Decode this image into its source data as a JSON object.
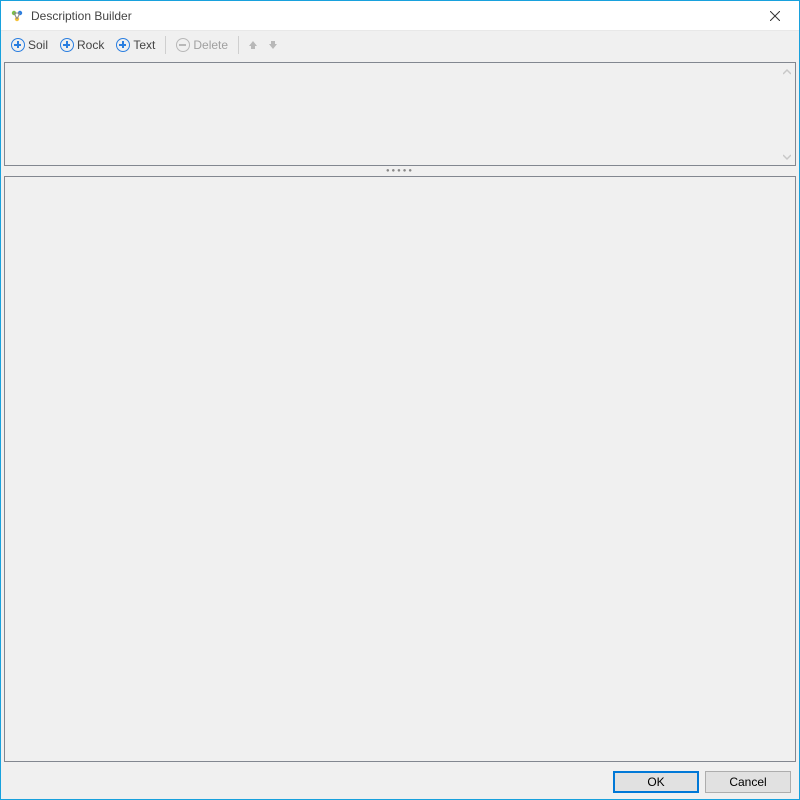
{
  "window": {
    "title": "Description Builder"
  },
  "toolbar": {
    "soil_label": "Soil",
    "rock_label": "Rock",
    "text_label": "Text",
    "delete_label": "Delete"
  },
  "footer": {
    "ok_label": "OK",
    "cancel_label": "Cancel"
  },
  "splitter": {
    "grip": "●●●●●"
  }
}
